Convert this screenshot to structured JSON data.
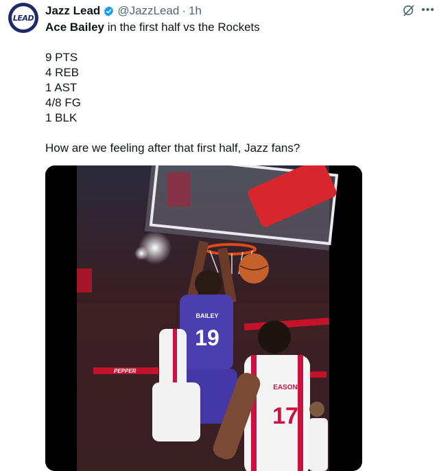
{
  "author": {
    "name": "Jazz Lead",
    "handle": "@JazzLead",
    "time": "1h",
    "avatar_text": "LEAD"
  },
  "tweet": {
    "headline_bold": "Ace Bailey",
    "headline_rest": " in the first half vs the Rockets",
    "stats": [
      "9 PTS",
      "4 REB",
      "1 AST",
      "4/8 FG",
      "1 BLK"
    ],
    "question": "How are we feeling after that first half, Jazz fans?"
  },
  "media": {
    "jersey_number_jazz": "19",
    "jersey_name_jazz": "BAILEY",
    "jersey_number_rockets": "17",
    "jersey_name_rockets": "EASON",
    "banner_text": "PEPPER"
  },
  "colors": {
    "verified_blue": "#1d9bf0",
    "jazz_purple": "#4b3fb0",
    "rockets_red": "#ce1141"
  }
}
